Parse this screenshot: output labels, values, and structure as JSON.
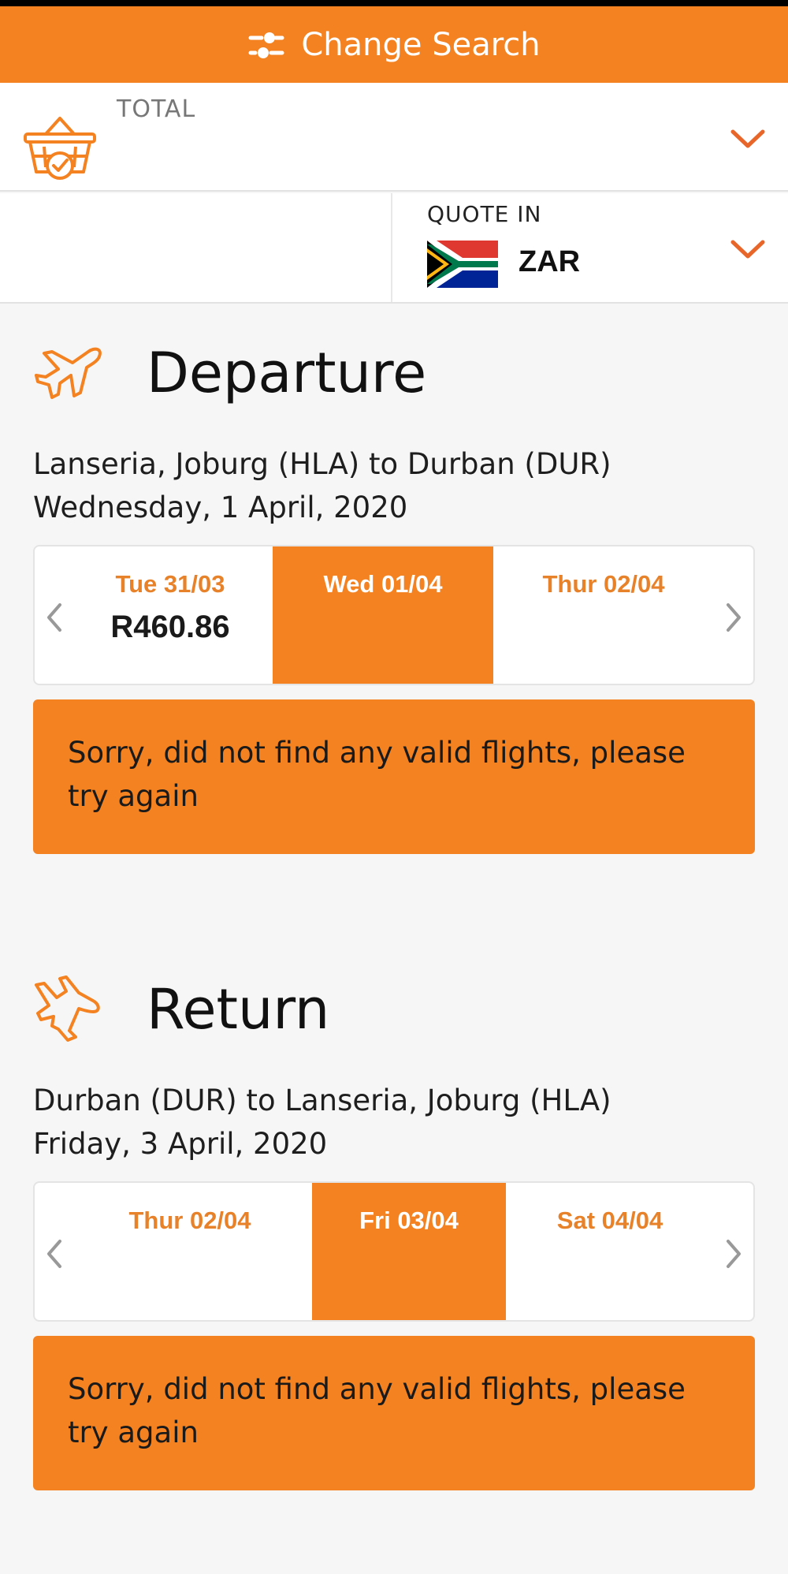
{
  "header": {
    "change_search_label": "Change Search",
    "icon": "sliders-icon"
  },
  "total": {
    "label": "TOTAL",
    "icon": "basket-icon"
  },
  "currency": {
    "label": "QUOTE IN",
    "code": "ZAR",
    "flag": "south-africa-flag"
  },
  "departure": {
    "title": "Departure",
    "route": "Lanseria, Joburg (HLA) to Durban (DUR)",
    "date": "Wednesday, 1 April, 2020",
    "days": [
      {
        "label": "Tue 31/03",
        "price": "R460.86",
        "selected": false
      },
      {
        "label": "Wed 01/04",
        "price": "",
        "selected": true
      },
      {
        "label": "Thur 02/04",
        "price": "",
        "selected": false
      }
    ],
    "message": "Sorry, did not find any valid flights, please try again"
  },
  "return": {
    "title": "Return",
    "route": "Durban (DUR) to Lanseria, Joburg (HLA)",
    "date": "Friday, 3 April, 2020",
    "days": [
      {
        "label": "Thur 02/04",
        "price": "",
        "selected": false
      },
      {
        "label": "Fri 03/04",
        "price": "",
        "selected": true
      },
      {
        "label": "Sat 04/04",
        "price": "",
        "selected": false
      }
    ],
    "message": "Sorry, did not find any valid flights, please try again"
  },
  "colors": {
    "accent": "#f48220",
    "accent_text": "#e8822a"
  }
}
